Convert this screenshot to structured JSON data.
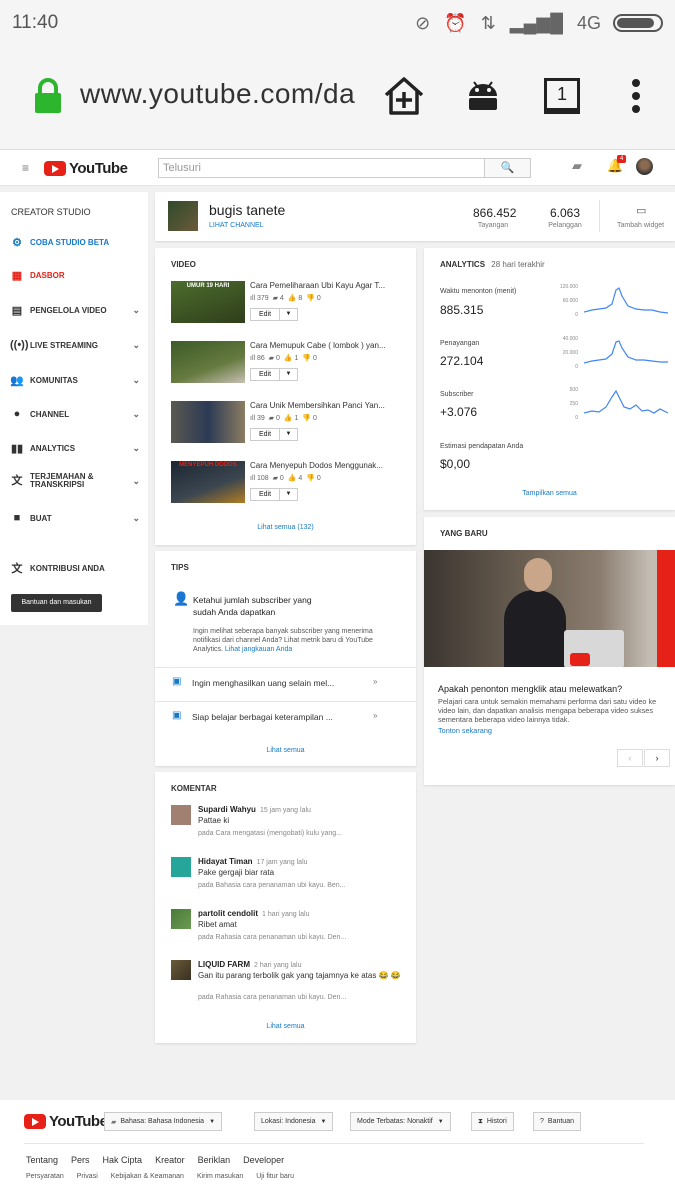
{
  "status_bar": {
    "time": "11:40",
    "network": "4G"
  },
  "browser": {
    "url": "www.youtube.com/da",
    "tab_count": "1"
  },
  "header": {
    "logo": "YouTube",
    "search_placeholder": "Telusuri",
    "notif_count": "4"
  },
  "sidebar": {
    "title": "CREATOR STUDIO",
    "items": [
      {
        "label": "COBA STUDIO BETA"
      },
      {
        "label": "DASBOR"
      },
      {
        "label": "PENGELOLA VIDEO"
      },
      {
        "label": "LIVE STREAMING"
      },
      {
        "label": "KOMUNITAS"
      },
      {
        "label": "CHANNEL"
      },
      {
        "label": "ANALYTICS"
      },
      {
        "label": "TERJEMAHAN & TRANSKRIPSI"
      },
      {
        "label": "BUAT"
      },
      {
        "label": "KONTRIBUSI ANDA"
      }
    ],
    "help_button": "Bantuan dan masukan"
  },
  "channel": {
    "name": "bugis tanete",
    "link": "LIHAT CHANNEL",
    "views": "866.452",
    "views_label": "Tayangan",
    "subs": "6.063",
    "subs_label": "Pelanggan",
    "widget_label": "Tambah widget"
  },
  "video_card": {
    "title": "VIDEO",
    "edit_label": "Edit",
    "see_all": "Lihat semua (132)",
    "videos": [
      {
        "title": "Cara Pemeliharaan Ubi Kayu Agar T...",
        "views": "379",
        "comments": "4",
        "likes": "8",
        "dislikes": "0",
        "thumb_text": "UMUR 19 HARI"
      },
      {
        "title": "Cara Memupuk Cabe ( lombok ) yan...",
        "views": "86",
        "comments": "0",
        "likes": "1",
        "dislikes": "0",
        "thumb_text": ""
      },
      {
        "title": "Cara Unik Membersihkan Panci Yan...",
        "views": "39",
        "comments": "0",
        "likes": "1",
        "dislikes": "0",
        "thumb_text": ""
      },
      {
        "title": "Cara Menyepuh Dodos Menggunak...",
        "views": "108",
        "comments": "0",
        "likes": "4",
        "dislikes": "0",
        "thumb_text": "MENYEPUH DODOS"
      }
    ]
  },
  "analytics": {
    "title": "ANALYTICS",
    "period": "28 hari terakhir",
    "watch_label": "Waktu menonton (menit)",
    "watch_value": "885.315",
    "views_label": "Penayangan",
    "views_value": "272.104",
    "subs_label": "Subscriber",
    "subs_value": "+3.076",
    "revenue_label": "Estimasi pendapatan Anda",
    "revenue_value": "$0,00",
    "see_all": "Tampilkan semua",
    "chart1_ticks": [
      "120.000",
      "60.000",
      "0"
    ],
    "chart2_ticks": [
      "40.000",
      "20.000",
      "0"
    ],
    "chart3_ticks": [
      "500",
      "250",
      "0"
    ]
  },
  "tips": {
    "title": "TIPS",
    "tip_title": "Ketahui jumlah subscriber yang sudah Anda dapatkan",
    "tip_body": "Ingin melihat seberapa banyak subscriber yang menerima notifikasi dari channel Anda? Lihat metrik baru di YouTube Analytics.",
    "tip_link": "Lihat jangkauan Anda",
    "item1": "Ingin menghasilkan uang selain mel...",
    "item2": "Siap belajar berbagai keterampilan ...",
    "see_all": "Lihat semua"
  },
  "whats_new": {
    "title": "YANG BARU",
    "heading": "Apakah penonton mengklik atau melewatkan?",
    "body": "Pelajari cara untuk semakin memahami performa dari satu video ke video lain, dan dapatkan analisis mengapa beberapa video sukses sementara beberapa video lainnya tidak.",
    "link": "Tonton sekarang"
  },
  "comments": {
    "title": "KOMENTAR",
    "see_all": "Lihat semua",
    "items": [
      {
        "name": "Supardi Wahyu",
        "time": "15 jam yang lalu",
        "text": "Pattae ki",
        "on": "pada Cara mengatasi (mengobati) kulu yang..."
      },
      {
        "name": "Hidayat Timan",
        "time": "17 jam yang lalu",
        "text": "Pake gergaji biar rata",
        "on": "pada Bahasia cara penanaman ubi kayu. Ben..."
      },
      {
        "name": "partolit cendolit",
        "time": "1 hari yang lalu",
        "text": "Ribet amat",
        "on": "pada Rahasia cara penanaman ubi kayu. Den..."
      },
      {
        "name": "LIQUID FARM",
        "time": "2 hari yang lalu",
        "text": "Gan itu parang terbolik gak yang tajamnya ke atas 😂 😂",
        "on": "pada Rahasia cara penanaman ubi kayu. Den..."
      }
    ]
  },
  "footer": {
    "logo": "YouTube",
    "lang": "Bahasa: Bahasa Indonesia",
    "loc": "Lokasi: Indonesia",
    "mode": "Mode Terbatas: Nonaktif",
    "history": "Histori",
    "help": "Bantuan",
    "links": [
      "Tentang",
      "Pers",
      "Hak Cipta",
      "Kreator",
      "Beriklan",
      "Developer"
    ],
    "links2": [
      "Persyaratan",
      "Privasi",
      "Kebijakan & Keamanan",
      "Kirim masukan",
      "Uji fitur baru"
    ]
  }
}
